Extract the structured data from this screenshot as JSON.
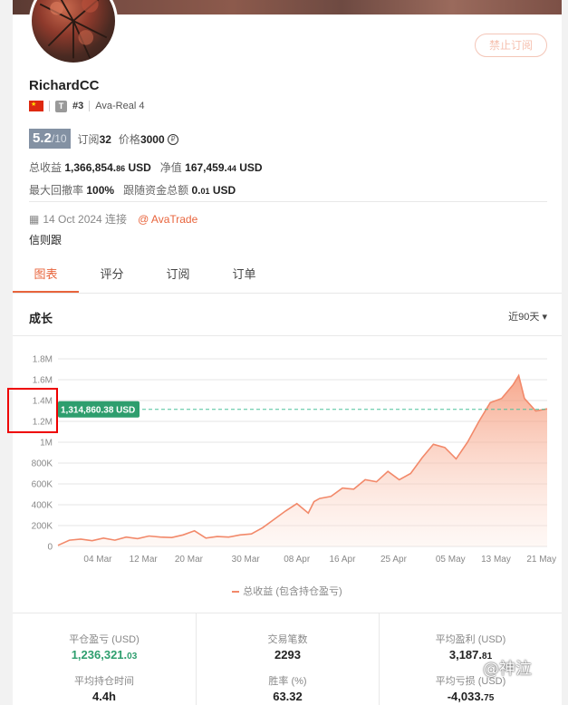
{
  "profile": {
    "name": "RichardCC",
    "ban_button": "禁止订阅",
    "tier_badge": "T",
    "rank": "#3",
    "server": "Ava-Real 4"
  },
  "score": {
    "value": "5.2",
    "max": "/10",
    "subs_label": "订阅",
    "subs_value": "32",
    "price_label": "价格",
    "price_value": "3000",
    "coin_icon": "coin-icon"
  },
  "stats": {
    "total_profit_label": "总收益",
    "total_profit_main": "1,366,854.",
    "total_profit_cents": "86",
    "total_profit_unit": "USD",
    "equity_label": "净值",
    "equity_main": "167,459.",
    "equity_cents": "44",
    "equity_unit": "USD",
    "max_dd_label": "最大回撤率",
    "max_dd_value": "100%",
    "follow_label": "跟随资金总额",
    "follow_main": "0.",
    "follow_cents": "01",
    "follow_unit": "USD"
  },
  "connection": {
    "date": "14 Oct 2024 连接",
    "broker": "@ AvaTrade"
  },
  "description": "信则跟",
  "tabs": [
    "图表",
    "评分",
    "订阅",
    "订单"
  ],
  "section": {
    "title": "成长",
    "range": "近90天 ▾"
  },
  "chart_data": {
    "type": "area",
    "series": [
      {
        "name": "总收益 (包含持仓盈亏)",
        "color": "#f2896a",
        "x": [
          "2025-02-25",
          "2025-02-27",
          "2025-03-01",
          "2025-03-03",
          "2025-03-05",
          "2025-03-07",
          "2025-03-09",
          "2025-03-11",
          "2025-03-13",
          "2025-03-15",
          "2025-03-17",
          "2025-03-19",
          "2025-03-21",
          "2025-03-23",
          "2025-03-25",
          "2025-03-27",
          "2025-03-29",
          "2025-03-31",
          "2025-04-02",
          "2025-04-04",
          "2025-04-06",
          "2025-04-08",
          "2025-04-10",
          "2025-04-11",
          "2025-04-12",
          "2025-04-14",
          "2025-04-16",
          "2025-04-18",
          "2025-04-20",
          "2025-04-22",
          "2025-04-24",
          "2025-04-26",
          "2025-04-28",
          "2025-04-30",
          "2025-05-02",
          "2025-05-04",
          "2025-05-06",
          "2025-05-08",
          "2025-05-10",
          "2025-05-12",
          "2025-05-14",
          "2025-05-16",
          "2025-05-17",
          "2025-05-18",
          "2025-05-20",
          "2025-05-22"
        ],
        "y": [
          10000,
          60000,
          70000,
          55000,
          80000,
          60000,
          90000,
          75000,
          100000,
          90000,
          85000,
          110000,
          150000,
          80000,
          95000,
          90000,
          110000,
          120000,
          180000,
          260000,
          340000,
          410000,
          320000,
          430000,
          460000,
          480000,
          560000,
          550000,
          640000,
          620000,
          720000,
          640000,
          700000,
          850000,
          980000,
          950000,
          840000,
          1000000,
          1200000,
          1380000,
          1420000,
          1550000,
          1640000,
          1420000,
          1300000,
          1320000
        ]
      }
    ],
    "marker_value": "1,314,860.38 USD",
    "marker_y": 1314860.38,
    "ylim": [
      0,
      1800000
    ],
    "y_ticks": [
      0,
      200000,
      400000,
      600000,
      800000,
      1000000,
      1200000,
      1400000,
      1600000,
      1800000
    ],
    "y_tick_labels": [
      "0",
      "200K",
      "400K",
      "600K",
      "800K",
      "1M",
      "1.2M",
      "1.4M",
      "1.6M",
      "1.8M"
    ],
    "x_ticks": [
      "2025-03-04",
      "2025-03-12",
      "2025-03-20",
      "2025-03-30",
      "2025-04-08",
      "2025-04-16",
      "2025-04-25",
      "2025-05-05",
      "2025-05-13",
      "2025-05-21"
    ],
    "x_tick_labels": [
      "04 Mar",
      "12 Mar",
      "20 Mar",
      "30 Mar",
      "08 Apr",
      "16 Apr",
      "25 Apr",
      "05 May",
      "13 May",
      "21 May"
    ],
    "grid": true,
    "legend_position": "bottom"
  },
  "bottom_stats": [
    {
      "label": "平仓盈亏 (USD)",
      "main": "1,236,321.",
      "cents": "03"
    },
    {
      "label": "交易笔数",
      "main": "2293",
      "cents": ""
    },
    {
      "label": "平均盈利 (USD)",
      "main": "3,187.",
      "cents": "81"
    },
    {
      "label": "平均持仓时间",
      "main": "4.4h",
      "cents": ""
    },
    {
      "label": "胜率 (%)",
      "main": "63.32",
      "cents": ""
    },
    {
      "label": "平均亏损 (USD)",
      "main": "-4,033.",
      "cents": "75"
    }
  ],
  "watermark": "@神泣"
}
